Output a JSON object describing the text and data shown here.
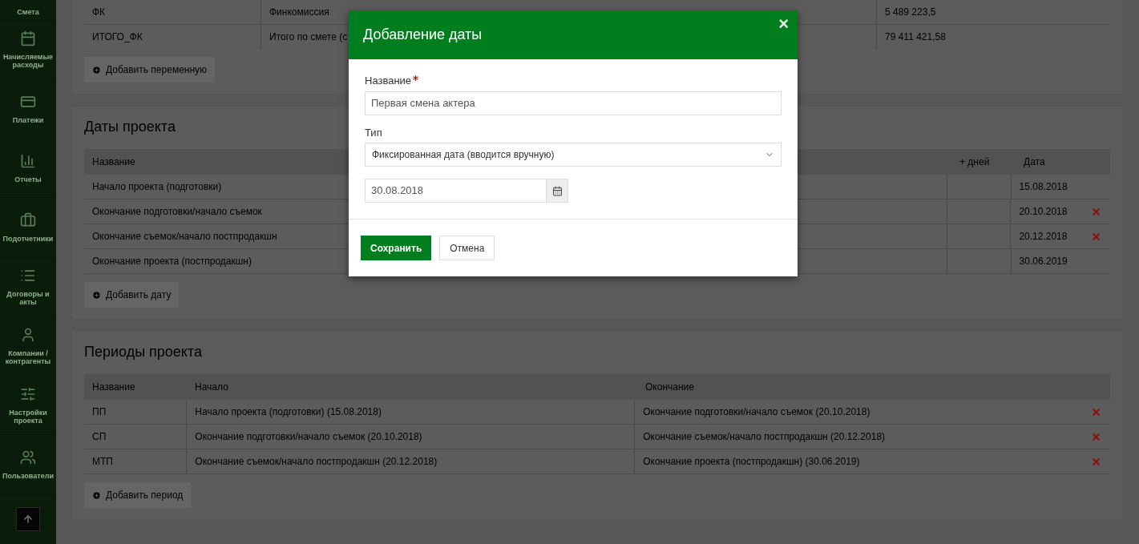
{
  "sidebar": {
    "items": [
      {
        "label": "Смета"
      },
      {
        "label": "Начисляемые расходы"
      },
      {
        "label": "Платежи"
      },
      {
        "label": "Отчеты"
      },
      {
        "label": "Подотчетники"
      },
      {
        "label": "Договоры и акты"
      },
      {
        "label": "Компании / контрагенты"
      },
      {
        "label": "Настройки проекта"
      },
      {
        "label": "Пользователи"
      }
    ]
  },
  "variables": {
    "rows": [
      {
        "code": "ФК",
        "description": "Финкомиссия",
        "value": "5 489 223,5"
      },
      {
        "code": "ИТОГО_ФК",
        "description": "Итого по смете (с",
        "value": "79 411 421,58"
      }
    ],
    "add_button": "Добавить переменную"
  },
  "dates": {
    "title": "Даты проекта",
    "columns": [
      "Название",
      "+ дней",
      "Дата"
    ],
    "rows": [
      {
        "name": "Начало проекта (подготовки)",
        "date": "15.08.2018",
        "deletable": false
      },
      {
        "name": "Окончание подготовки/начало съемок",
        "date": "20.10.2018",
        "deletable": true
      },
      {
        "name": "Окончание съемок/начало постпродакшн",
        "date": "20.12.2018",
        "deletable": true
      },
      {
        "name": "Окончание проекта (постпродакшн)",
        "date": "30.06.2019",
        "deletable": false
      }
    ],
    "add_button": "Добавить дату"
  },
  "periods": {
    "title": "Периоды проекта",
    "columns": [
      "Название",
      "Начало",
      "Окончание"
    ],
    "rows": [
      {
        "name": "ПП",
        "start": "Начало проекта (подготовки) (15.08.2018)",
        "end": "Окончание подготовки/начало съемок (20.10.2018)",
        "deletable": true
      },
      {
        "name": "СП",
        "start": "Окончание подготовки/начало съемок (20.10.2018)",
        "end": "Окончание съемок/начало постпродакшн (20.12.2018)",
        "deletable": true
      },
      {
        "name": "МТП",
        "start": "Окончание съемок/начало постпродакшн (20.12.2018)",
        "end": "Окончание проекта (постпродакшн) (30.06.2019)",
        "deletable": true
      }
    ],
    "add_button": "Добавить период"
  },
  "dialog": {
    "title": "Добавление даты",
    "close": "×",
    "name_label": "Название",
    "name_required": true,
    "name_value": "Первая смена актера",
    "type_label": "Тип",
    "type_value": "Фиксированная дата (вводится вручную)",
    "date_value": "30.08.2018",
    "buttons": [
      {
        "label": "Сохранить",
        "kind": "primary"
      },
      {
        "label": "Отмена",
        "kind": "secondary"
      }
    ]
  }
}
